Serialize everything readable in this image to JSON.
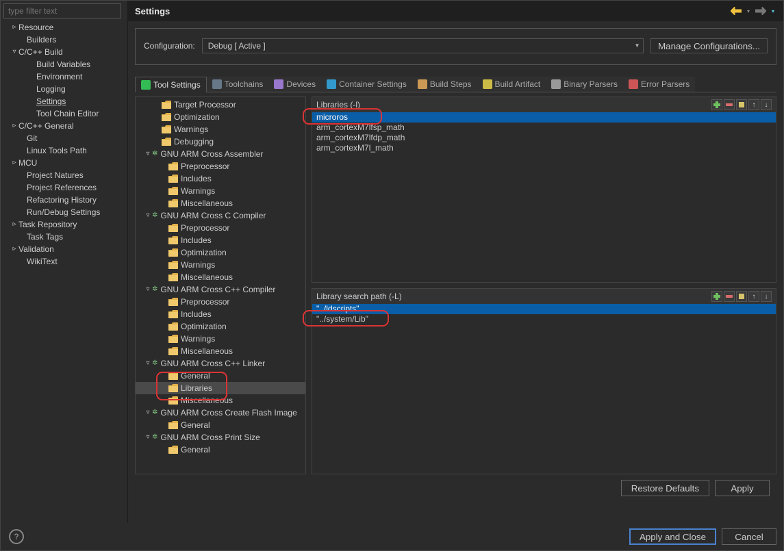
{
  "filterPlaceholder": "type filter text",
  "title": "Settings",
  "categories": [
    {
      "label": "Resource",
      "indent": 14,
      "tw": "▹"
    },
    {
      "label": "Builders",
      "indent": 26,
      "tw": ""
    },
    {
      "label": "C/C++ Build",
      "indent": 14,
      "tw": "▿"
    },
    {
      "label": "Build Variables",
      "indent": 40,
      "tw": ""
    },
    {
      "label": "Environment",
      "indent": 40,
      "tw": ""
    },
    {
      "label": "Logging",
      "indent": 40,
      "tw": ""
    },
    {
      "label": "Settings",
      "indent": 40,
      "tw": "",
      "selected": true
    },
    {
      "label": "Tool Chain Editor",
      "indent": 40,
      "tw": ""
    },
    {
      "label": "C/C++ General",
      "indent": 14,
      "tw": "▹"
    },
    {
      "label": "Git",
      "indent": 26,
      "tw": ""
    },
    {
      "label": "Linux Tools Path",
      "indent": 26,
      "tw": ""
    },
    {
      "label": "MCU",
      "indent": 14,
      "tw": "▹"
    },
    {
      "label": "Project Natures",
      "indent": 26,
      "tw": ""
    },
    {
      "label": "Project References",
      "indent": 26,
      "tw": ""
    },
    {
      "label": "Refactoring History",
      "indent": 26,
      "tw": ""
    },
    {
      "label": "Run/Debug Settings",
      "indent": 26,
      "tw": ""
    },
    {
      "label": "Task Repository",
      "indent": 14,
      "tw": "▹"
    },
    {
      "label": "Task Tags",
      "indent": 26,
      "tw": ""
    },
    {
      "label": "Validation",
      "indent": 14,
      "tw": "▹"
    },
    {
      "label": "WikiText",
      "indent": 26,
      "tw": ""
    }
  ],
  "config": {
    "label": "Configuration:",
    "value": "Debug  [ Active ]",
    "manage": "Manage Configurations..."
  },
  "tabs": [
    {
      "label": "Tool Settings",
      "iconClass": "ti-tool",
      "active": true
    },
    {
      "label": "Toolchains",
      "iconClass": "ti-tc"
    },
    {
      "label": "Devices",
      "iconClass": "ti-dev"
    },
    {
      "label": "Container Settings",
      "iconClass": "ti-cont"
    },
    {
      "label": "Build Steps",
      "iconClass": "ti-steps"
    },
    {
      "label": "Build Artifact",
      "iconClass": "ti-art"
    },
    {
      "label": "Binary Parsers",
      "iconClass": "ti-bin"
    },
    {
      "label": "Error Parsers",
      "iconClass": "ti-err"
    }
  ],
  "toolsTree": [
    {
      "label": "Target Processor",
      "indent": 26,
      "icon": "folder"
    },
    {
      "label": "Optimization",
      "indent": 26,
      "icon": "folder"
    },
    {
      "label": "Warnings",
      "indent": 26,
      "icon": "folder"
    },
    {
      "label": "Debugging",
      "indent": 26,
      "icon": "folder"
    },
    {
      "label": "GNU ARM Cross Assembler",
      "indent": 12,
      "tw": "▿",
      "icon": "cog"
    },
    {
      "label": "Preprocessor",
      "indent": 36,
      "icon": "folder"
    },
    {
      "label": "Includes",
      "indent": 36,
      "icon": "folder"
    },
    {
      "label": "Warnings",
      "indent": 36,
      "icon": "folder"
    },
    {
      "label": "Miscellaneous",
      "indent": 36,
      "icon": "folder"
    },
    {
      "label": "GNU ARM Cross C Compiler",
      "indent": 12,
      "tw": "▿",
      "icon": "cog"
    },
    {
      "label": "Preprocessor",
      "indent": 36,
      "icon": "folder"
    },
    {
      "label": "Includes",
      "indent": 36,
      "icon": "folder"
    },
    {
      "label": "Optimization",
      "indent": 36,
      "icon": "folder"
    },
    {
      "label": "Warnings",
      "indent": 36,
      "icon": "folder"
    },
    {
      "label": "Miscellaneous",
      "indent": 36,
      "icon": "folder"
    },
    {
      "label": "GNU ARM Cross C++ Compiler",
      "indent": 12,
      "tw": "▿",
      "icon": "cog"
    },
    {
      "label": "Preprocessor",
      "indent": 36,
      "icon": "folder"
    },
    {
      "label": "Includes",
      "indent": 36,
      "icon": "folder"
    },
    {
      "label": "Optimization",
      "indent": 36,
      "icon": "folder"
    },
    {
      "label": "Warnings",
      "indent": 36,
      "icon": "folder"
    },
    {
      "label": "Miscellaneous",
      "indent": 36,
      "icon": "folder"
    },
    {
      "label": "GNU ARM Cross C++ Linker",
      "indent": 12,
      "tw": "▿",
      "icon": "cog"
    },
    {
      "label": "General",
      "indent": 36,
      "icon": "folder"
    },
    {
      "label": "Libraries",
      "indent": 36,
      "icon": "folder",
      "selected": true,
      "ring": true
    },
    {
      "label": "Miscellaneous",
      "indent": 36,
      "icon": "folder"
    },
    {
      "label": "GNU ARM Cross Create Flash Image",
      "indent": 12,
      "tw": "▿",
      "icon": "cog"
    },
    {
      "label": "General",
      "indent": 36,
      "icon": "folder"
    },
    {
      "label": "GNU ARM Cross Print Size",
      "indent": 12,
      "tw": "▿",
      "icon": "cog"
    },
    {
      "label": "General",
      "indent": 36,
      "icon": "folder"
    }
  ],
  "librariesTitle": "Libraries (-l)",
  "librariesItems": [
    {
      "label": "microros",
      "selected": true,
      "ring": true
    },
    {
      "label": "arm_cortexM7lfsp_math"
    },
    {
      "label": "arm_cortexM7lfdp_math"
    },
    {
      "label": "arm_cortexM7l_math"
    }
  ],
  "searchPathTitle": "Library search path (-L)",
  "searchPathItems": [
    {
      "label": "\"../ldscripts\"",
      "selected": true
    },
    {
      "label": "\"../system/Lib\"",
      "ring": true
    }
  ],
  "buttons": {
    "restoreDefaults": "Restore Defaults",
    "apply": "Apply",
    "applyAndClose": "Apply and Close",
    "cancel": "Cancel"
  }
}
